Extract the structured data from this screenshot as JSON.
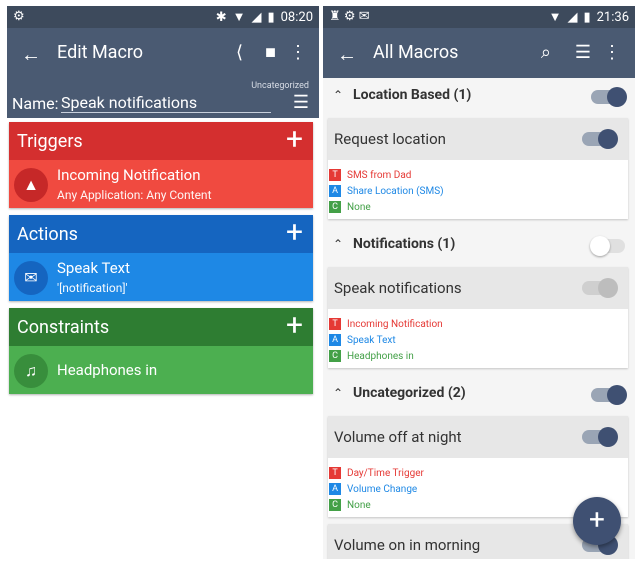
{
  "left": {
    "status": {
      "time": "08:20"
    },
    "appbar": {
      "title": "Edit Macro",
      "category": "Uncategorized"
    },
    "name_label": "Name:",
    "name_value": "Speak notifications",
    "cards": {
      "triggers": {
        "label": "Triggers",
        "item_title": "Incoming Notification",
        "item_sub": "Any Application: Any Content"
      },
      "actions": {
        "label": "Actions",
        "item_title": "Speak Text",
        "item_sub": "'[notification]'"
      },
      "constraints": {
        "label": "Constraints",
        "item_title": "Headphones in"
      }
    },
    "colors": {
      "triggers": "#d42f2f",
      "actions": "#1565c0",
      "constraints": "#2e7d32",
      "appbar": "#4a5a72"
    }
  },
  "right": {
    "status": {
      "time": "21:36"
    },
    "appbar": {
      "title": "All Macros"
    },
    "groups": [
      {
        "title": "Location Based (1)",
        "enabled": true
      },
      {
        "title": "Notifications (1)",
        "enabled": false
      },
      {
        "title": "Uncategorized (2)",
        "enabled": true
      }
    ],
    "macros": [
      {
        "title": "Request location",
        "trigger": "SMS from Dad",
        "action": "Share Location (SMS)",
        "constraint": "None"
      },
      {
        "title": "Speak notifications",
        "trigger": "Incoming Notification",
        "action": "Speak Text",
        "constraint": "Headphones in"
      },
      {
        "title": "Volume off at night",
        "trigger": "Day/Time Trigger",
        "action": "Volume Change",
        "constraint": "None"
      },
      {
        "title": "Volume on in morning"
      }
    ],
    "badges": {
      "trigger": "T",
      "action": "A",
      "constraint": "C"
    }
  }
}
